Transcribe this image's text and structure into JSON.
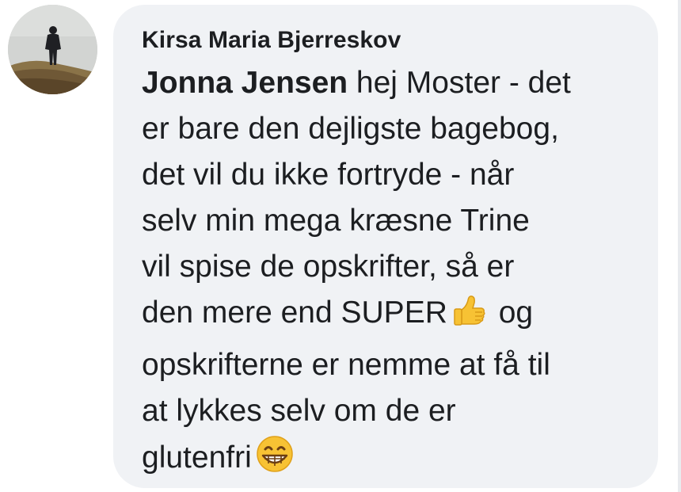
{
  "comment": {
    "author": "Kirsa Maria Bjerreskov",
    "mention": "Jonna Jensen",
    "text_lines": [
      " hej Moster - det",
      "er bare den dejligste bagebog,",
      "det vil du ikke fortryde -  når",
      "selv min mega kræsne Trine",
      "vil spise de opskrifter, så er",
      "den mere  end SUPER"
    ],
    "text_after_thumb": " og",
    "text_lines_2": [
      "opskrifterne er nemme at få til",
      "at lykkes selv om de er",
      "glutenfri"
    ],
    "icons": {
      "thumbs_up": "thumbs-up-emoji",
      "grin": "grinning-face-emoji"
    }
  },
  "colors": {
    "bubble_bg": "#f0f2f5",
    "text": "#1c1e21",
    "emoji_yellow": "#f7c234"
  }
}
